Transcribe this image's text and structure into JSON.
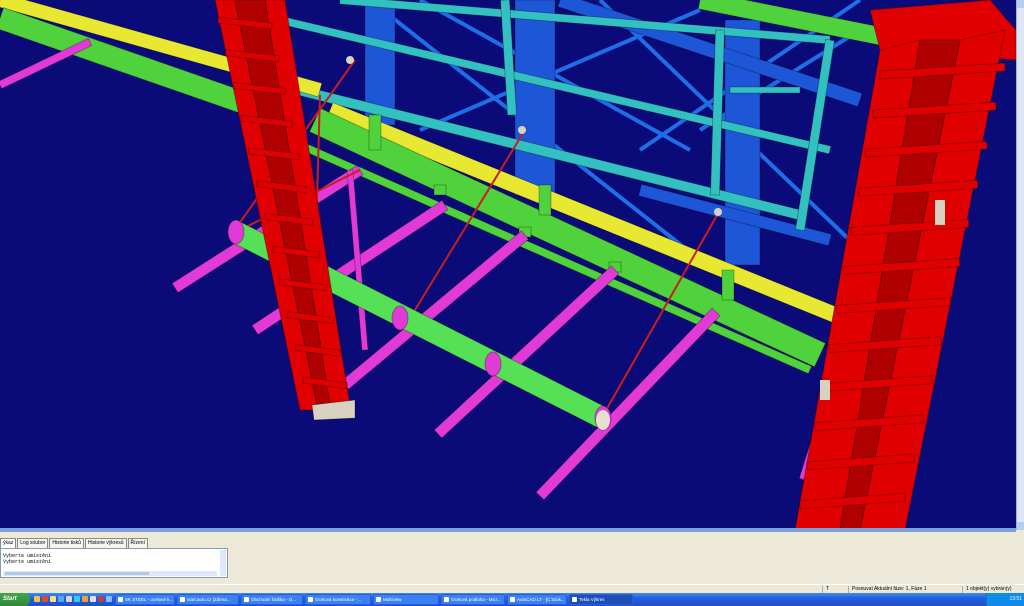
{
  "viewport": {
    "background": "#0a0a78",
    "colors": {
      "red_column": "#e00000",
      "blue_column": "#1e56d8",
      "cyan_frame": "#33c0c0",
      "green_beam": "#4fd23c",
      "yellow_beam": "#e8e832",
      "magenta_beam": "#e23ad6",
      "pipe": "#55e055",
      "tie_rod": "#c81e1e",
      "brace": "#1e6ee8"
    }
  },
  "panel": {
    "tabs": [
      "ýkaz",
      "Log soubor",
      "Historie tisků",
      "Historie výkresů",
      "Řízení"
    ],
    "console_lines": [
      "Vyberte umístění",
      "Vyberte umístění"
    ]
  },
  "statusbar": {
    "mode": "T",
    "move_text": "Posouvat Aktuální fáze: 1, Fáze 1",
    "selection_text": "1 objekt(y) vybrán(y)"
  },
  "taskbar": {
    "start_label": "Start",
    "windows": [
      {
        "label": "SK STEEL - ocelové k..."
      },
      {
        "label": "start.auto.cz [Zdena..."
      },
      {
        "label": "Obchodní fotiška - O..."
      },
      {
        "label": "Ocelová konstrukce -..."
      },
      {
        "label": "Multiview"
      },
      {
        "label": "Ocelová podlaha - Micr..."
      },
      {
        "label": "AutoCAD LT - [C:\\Dok..."
      },
      {
        "label": "Tekla Výkres"
      }
    ],
    "clock": "13:51"
  }
}
